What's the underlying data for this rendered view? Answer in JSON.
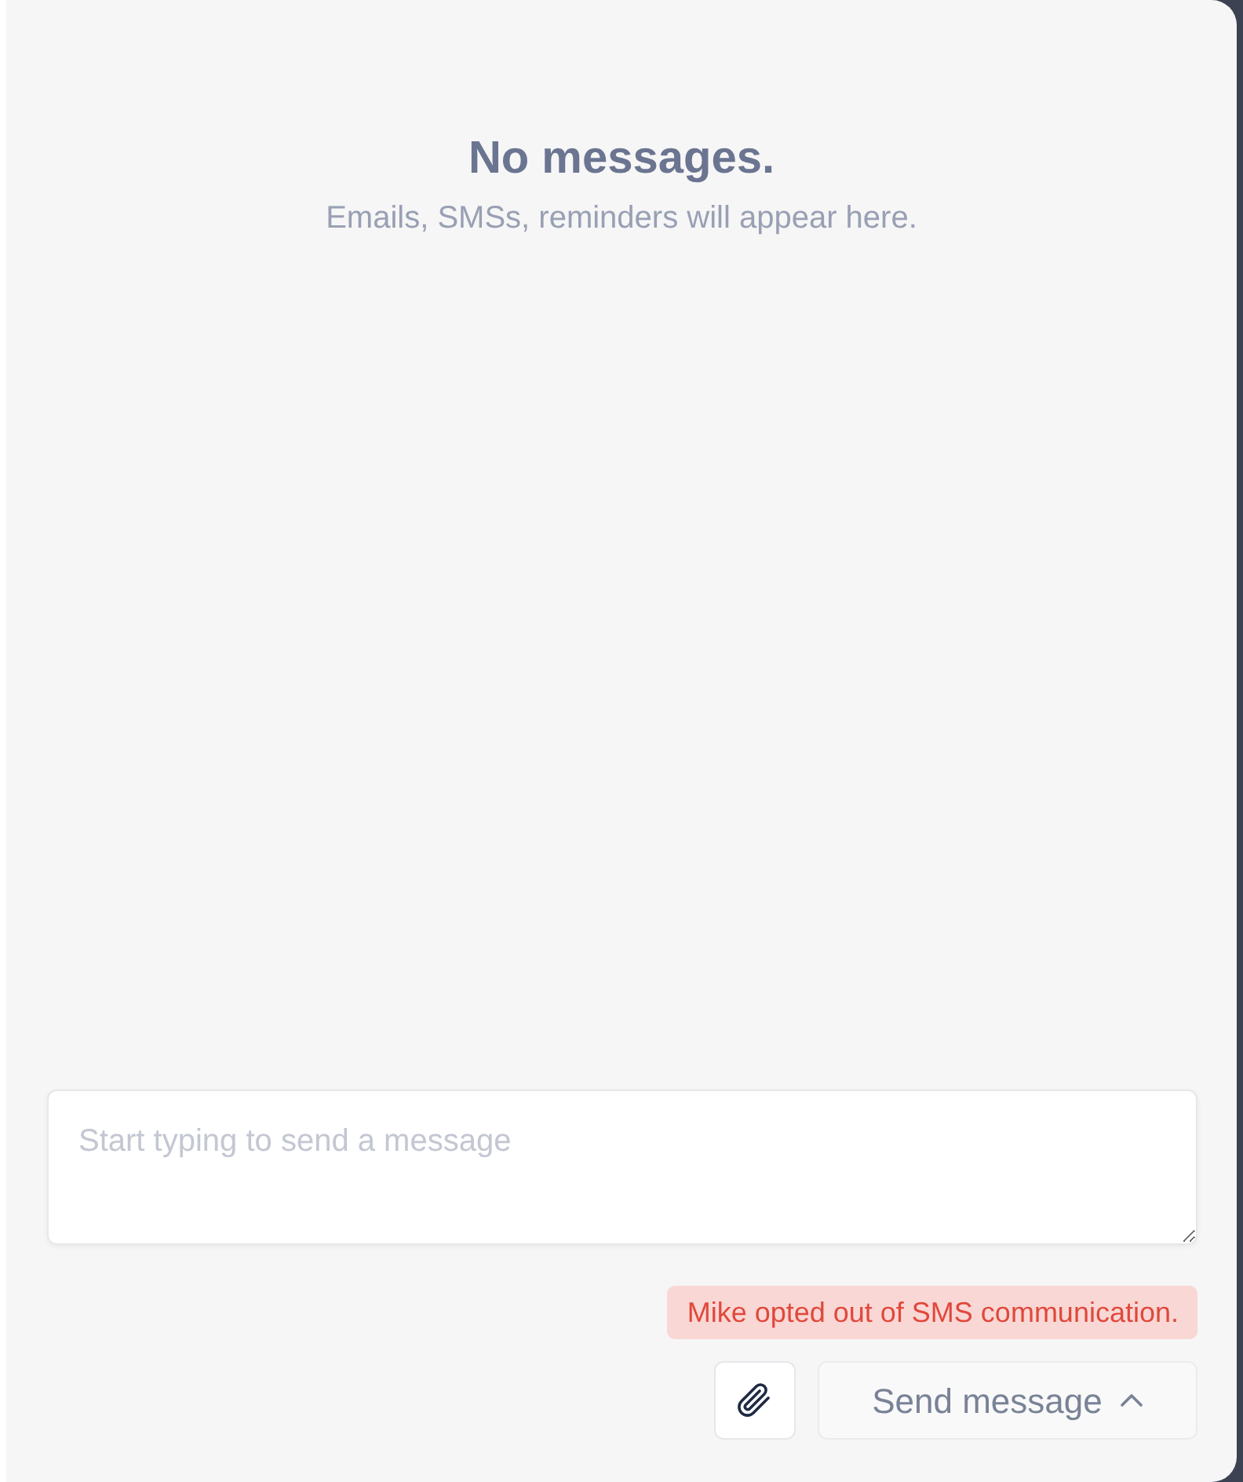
{
  "empty_state": {
    "title": "No messages.",
    "subtitle": "Emails, SMSs, reminders will appear here."
  },
  "composer": {
    "placeholder": "Start typing to send a message"
  },
  "notice": {
    "text": "Mike opted out of SMS communication."
  },
  "send_button": {
    "label": "Send message"
  }
}
